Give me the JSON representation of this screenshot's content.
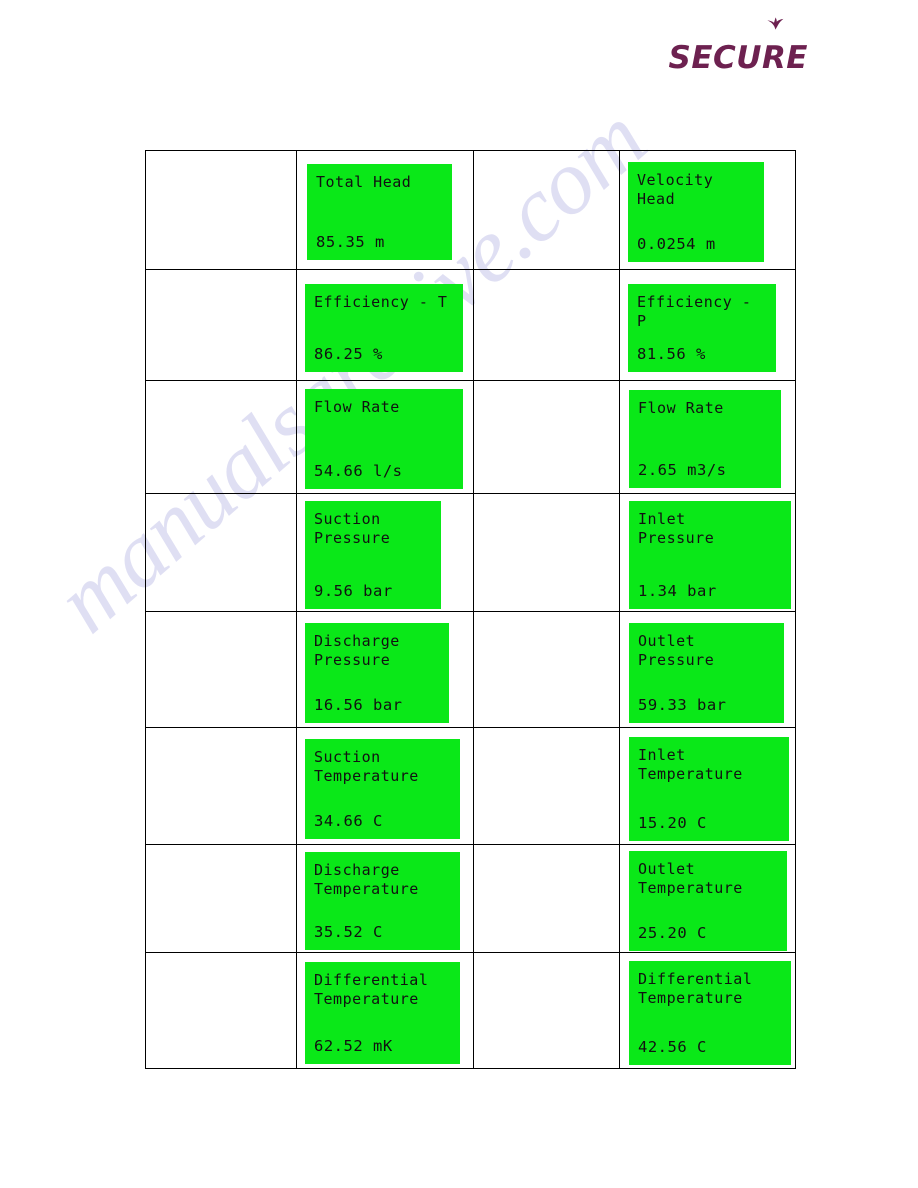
{
  "brand": {
    "logo_text": "SECURE",
    "logo_color": "#6d2150",
    "bird_icon": "bird-icon"
  },
  "watermark": {
    "text": "manualsarchive.com",
    "color": "#9696d7"
  },
  "display": {
    "screen_bg": "#0ae818",
    "screen_fg": "#111111"
  },
  "table": {
    "rows": [
      {
        "id": "r1",
        "left_screen": {
          "label": "Total Head",
          "value": "85.35 m"
        },
        "right_screen": {
          "label": "Velocity\nHead",
          "value": "0.0254 m"
        }
      },
      {
        "id": "r2",
        "left_screen": {
          "label": "Efficiency - T",
          "value": "86.25 %"
        },
        "right_screen": {
          "label": "Efficiency - P",
          "value": "81.56 %"
        }
      },
      {
        "id": "r3",
        "left_screen": {
          "label": "Flow Rate",
          "value": "54.66 l/s"
        },
        "right_screen": {
          "label": "Flow Rate",
          "value": "2.65 m3/s"
        }
      },
      {
        "id": "r4",
        "left_screen": {
          "label": "Suction\nPressure",
          "value": "9.56 bar"
        },
        "right_screen": {
          "label": "Inlet\nPressure",
          "value": "1.34 bar"
        }
      },
      {
        "id": "r5",
        "left_screen": {
          "label": "Discharge\nPressure",
          "value": "16.56 bar"
        },
        "right_screen": {
          "label": "Outlet\nPressure",
          "value": "59.33 bar"
        }
      },
      {
        "id": "r6",
        "left_screen": {
          "label": "Suction\nTemperature",
          "value": "34.66 C"
        },
        "right_screen": {
          "label": "Inlet\nTemperature",
          "value": "15.20 C"
        }
      },
      {
        "id": "r7",
        "left_screen": {
          "label": "Discharge\nTemperature",
          "value": "35.52 C"
        },
        "right_screen": {
          "label": "Outlet\nTemperature",
          "value": "25.20 C"
        }
      },
      {
        "id": "r8",
        "left_screen": {
          "label": "Differential\nTemperature",
          "value": "62.52 mK"
        },
        "right_screen": {
          "label": "Differential\nTemperature",
          "value": "42.56 C"
        }
      }
    ]
  }
}
